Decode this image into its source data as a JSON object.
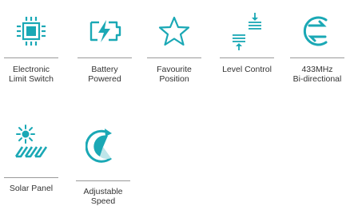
{
  "features": [
    {
      "id": "electronic-limit-switch",
      "icon": "chip-icon",
      "label": "Electronic\nLimit Switch"
    },
    {
      "id": "battery-powered",
      "icon": "battery-charging-icon",
      "label": "Battery\nPowered"
    },
    {
      "id": "favourite-position",
      "icon": "star-icon",
      "label": "Favourite\nPosition"
    },
    {
      "id": "level-control",
      "icon": "level-control-icon",
      "label": "Level Control"
    },
    {
      "id": "433mhz-bi-directional",
      "icon": "signal-icon",
      "label": "433MHz\nBi-directional"
    },
    {
      "id": "solar-panel",
      "icon": "solar-panel-icon",
      "label": "Solar Panel"
    },
    {
      "id": "adjustable-speed",
      "icon": "speed-icon",
      "label": "Adjustable\nSpeed"
    }
  ],
  "colors": {
    "accent": "#1aa8b5",
    "rule": "#9a9a9a",
    "text": "#333333"
  }
}
